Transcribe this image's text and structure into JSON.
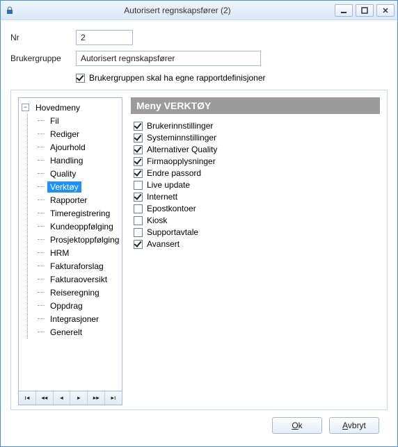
{
  "window": {
    "title": "Autorisert regnskapsfører (2)"
  },
  "form": {
    "nr_label": "Nr",
    "nr_value": "2",
    "group_label": "Brukergruppe",
    "group_value": "Autorisert regnskapsfører",
    "own_reports_label": "Brukergruppen skal ha egne rapportdefinisjoner",
    "own_reports_checked": true
  },
  "tree": {
    "root": "Hovedmeny",
    "root_children": [
      "Fil",
      "Rediger",
      "Ajourhold",
      "Handling",
      "Quality",
      "Verktøy"
    ],
    "selected": "Verktøy",
    "siblings": [
      "Rapporter",
      "Timeregistrering",
      "Kundeoppfølging",
      "Prosjektoppfølging",
      "HRM",
      "Fakturaforslag",
      "Fakturaoversikt",
      "Reiseregning",
      "Oppdrag",
      "Integrasjoner",
      "Generelt"
    ]
  },
  "panel": {
    "header": "Meny VERKTØY",
    "items": [
      {
        "label": "Brukerinnstillinger",
        "checked": true
      },
      {
        "label": "Systeminnstillinger",
        "checked": true
      },
      {
        "label": "Alternativer Quality",
        "checked": true
      },
      {
        "label": "Firmaopplysninger",
        "checked": true
      },
      {
        "label": "Endre passord",
        "checked": true
      },
      {
        "label": "Live update",
        "checked": false
      },
      {
        "label": "Internett",
        "checked": true
      },
      {
        "label": "Epostkontoer",
        "checked": false
      },
      {
        "label": "Kiosk",
        "checked": false
      },
      {
        "label": "Supportavtale",
        "checked": false
      },
      {
        "label": "Avansert",
        "checked": true
      }
    ]
  },
  "buttons": {
    "ok_prefix": "O",
    "ok_rest": "k",
    "cancel_prefix": "A",
    "cancel_rest": "vbryt"
  }
}
